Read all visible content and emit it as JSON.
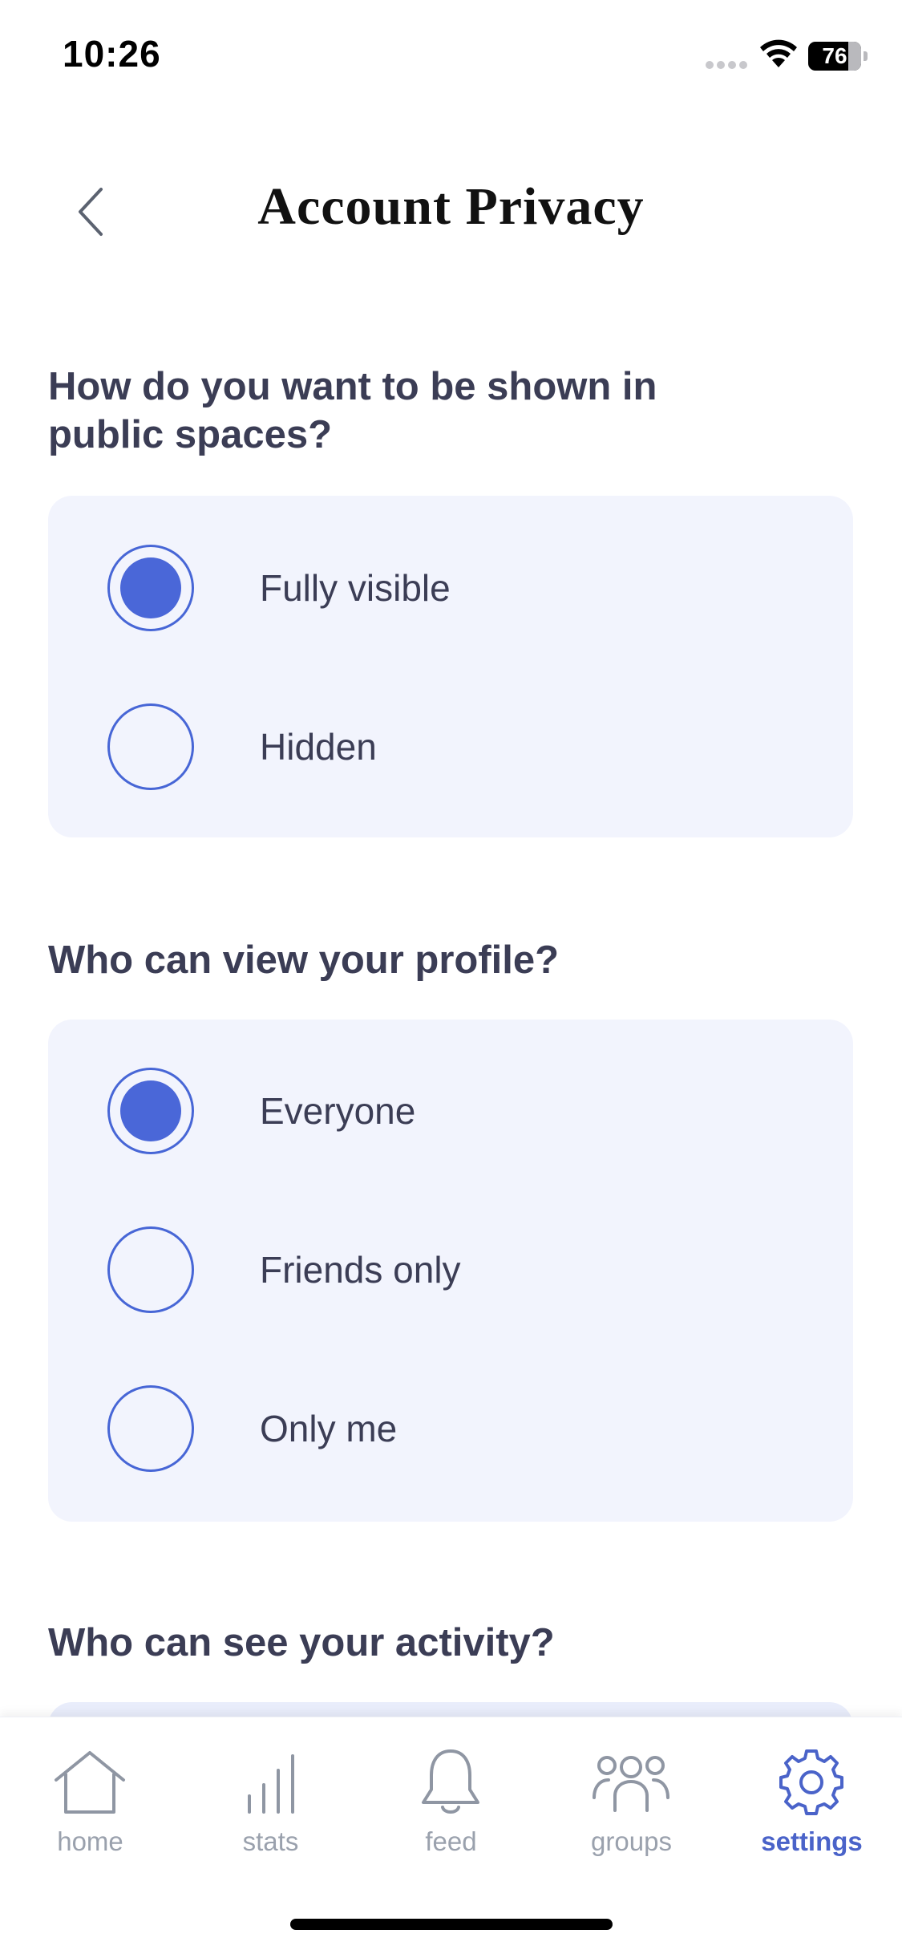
{
  "status_bar": {
    "time": "10:26",
    "battery_level": "76",
    "battery_fraction": 0.76
  },
  "header": {
    "title": "Account Privacy",
    "back_icon": "chevron-left-icon"
  },
  "sections": [
    {
      "heading": "How do you want to be shown in public spaces?",
      "options": [
        {
          "label": "Fully visible",
          "selected": true
        },
        {
          "label": "Hidden",
          "selected": false
        }
      ]
    },
    {
      "heading": "Who can view your profile?",
      "options": [
        {
          "label": "Everyone",
          "selected": true
        },
        {
          "label": "Friends only",
          "selected": false
        },
        {
          "label": "Only me",
          "selected": false
        }
      ]
    },
    {
      "heading": "Who can see your activity?",
      "options": []
    }
  ],
  "bottom_nav": {
    "items": [
      {
        "label": "home",
        "icon": "home-icon",
        "active": false
      },
      {
        "label": "stats",
        "icon": "bar-chart-icon",
        "active": false
      },
      {
        "label": "feed",
        "icon": "bell-icon",
        "active": false
      },
      {
        "label": "groups",
        "icon": "people-icon",
        "active": false
      },
      {
        "label": "settings",
        "icon": "gear-icon",
        "active": true
      }
    ]
  },
  "colors": {
    "accent": "#4a67d8",
    "card_background": "#f2f4fd",
    "text": "#3b3d55",
    "nav_inactive": "#9aa1ad"
  }
}
